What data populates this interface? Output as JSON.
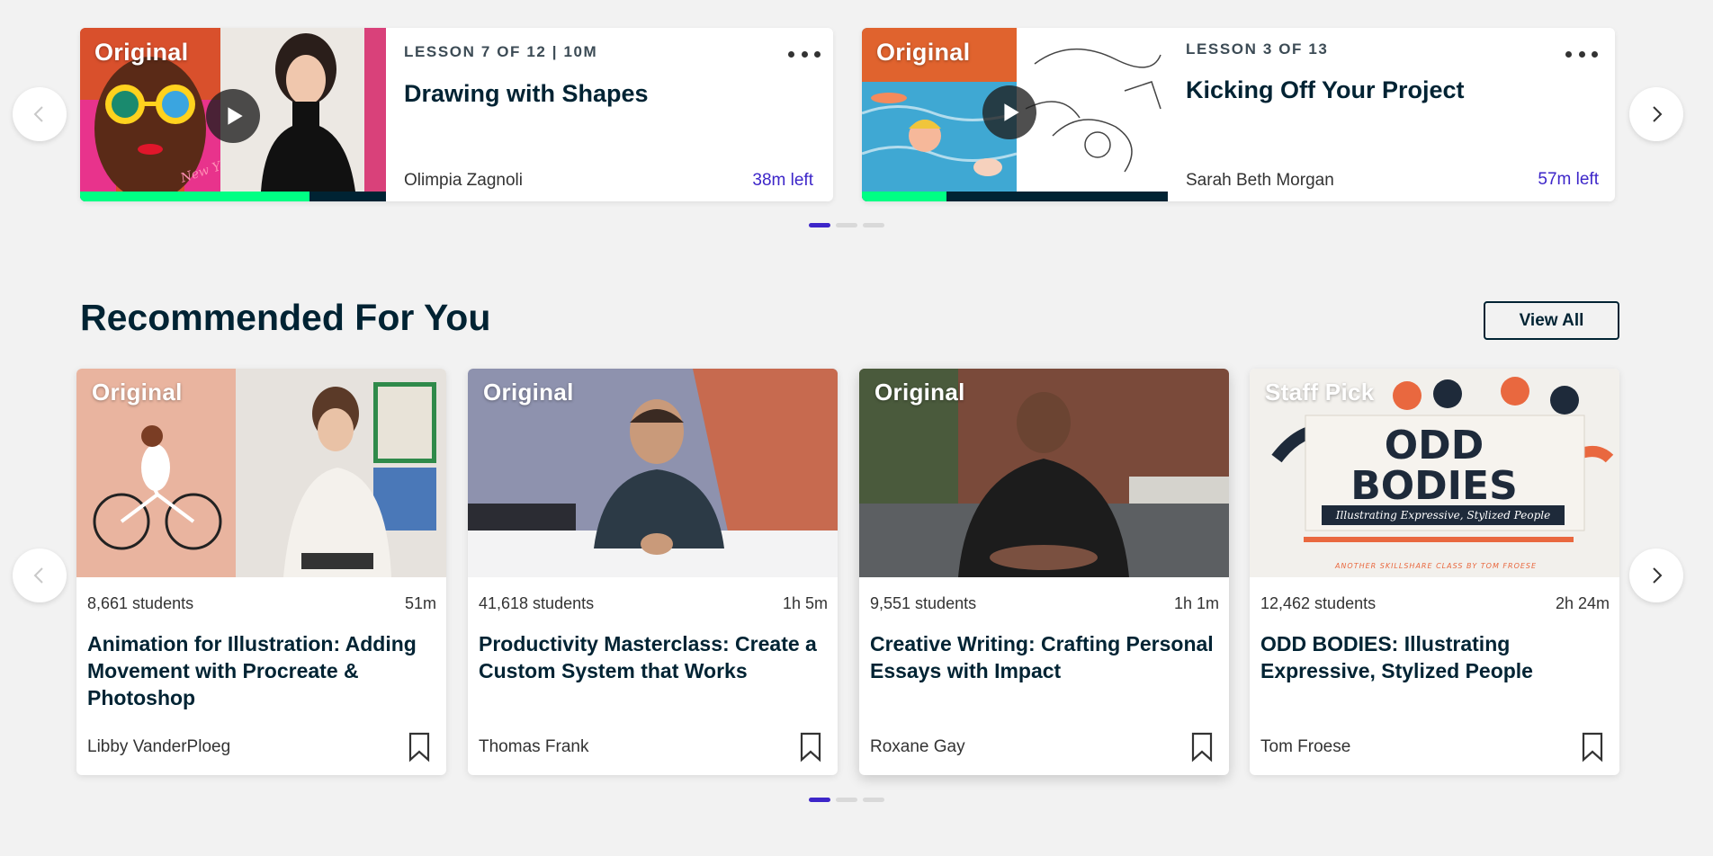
{
  "continue_watching": {
    "cards": [
      {
        "badge": "Original",
        "lesson": "LESSON 7 OF 12 | 10M",
        "title": "Drawing with Shapes",
        "author": "Olimpia Zagnoli",
        "time_left": "38m left",
        "progress": 0.75,
        "thumbnail_text": "New York"
      },
      {
        "badge": "Original",
        "lesson": "LESSON 3 OF 13",
        "title": "Kicking Off Your Project",
        "author": "Sarah Beth Morgan",
        "time_left": "57m left",
        "progress": 0.28
      }
    ],
    "pager": {
      "pages": 3,
      "active": 0
    }
  },
  "recommended": {
    "title": "Recommended For You",
    "view_all_label": "View All",
    "cards": [
      {
        "badge": "Original",
        "students": "8,661 students",
        "duration": "51m",
        "title": "Animation for Illustration: Adding Movement with Procreate & Photoshop",
        "author": "Libby VanderPloeg"
      },
      {
        "badge": "Original",
        "students": "41,618 students",
        "duration": "1h 5m",
        "title": "Productivity Masterclass: Create a Custom System that Works",
        "author": "Thomas Frank"
      },
      {
        "badge": "Original",
        "students": "9,551 students",
        "duration": "1h 1m",
        "title": "Creative Writing: Crafting Personal Essays with Impact",
        "author": "Roxane Gay"
      },
      {
        "badge": "Staff Pick",
        "students": "12,462 students",
        "duration": "2h 24m",
        "title": "ODD BODIES: Illustrating Expressive, Stylized People",
        "author": "Tom Froese",
        "thumbnail_text": {
          "line1": "ODD",
          "line2": "BODIES",
          "tagline": "Illustrating Expressive, Stylized People",
          "footer": "ANOTHER SKILLSHARE CLASS BY TOM FROESE"
        }
      }
    ],
    "pager": {
      "pages": 3,
      "active": 0
    }
  },
  "colors": {
    "accent": "#3d26c9",
    "progress": "#00ff84",
    "text": "#002333"
  }
}
